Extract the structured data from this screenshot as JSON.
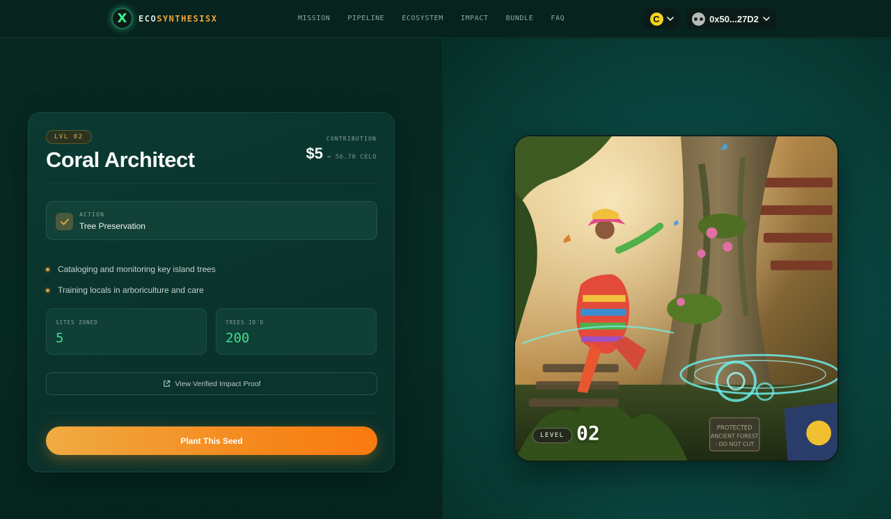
{
  "brand": {
    "badge": "X",
    "name_part1": "ECO",
    "name_part2": "SYNTHESIS",
    "name_part3": "X"
  },
  "nav": {
    "items": [
      "MISSION",
      "PIPELINE",
      "ECOSYSTEM",
      "IMPACT",
      "BUNDLE",
      "FAQ"
    ]
  },
  "wallet": {
    "token_symbol": "C",
    "token_icon": "celo-coin-icon",
    "address": "0x50...27D2"
  },
  "card": {
    "level_pill": "LVL 02",
    "title": "Coral Architect",
    "contribution_label": "CONTRIBUTION",
    "contribution_usd": "$5",
    "contribution_celo": "≈ 56.70 CELO",
    "action_label": "ACTION",
    "action_value": "Tree Preservation",
    "bullets": [
      "Cataloging and monitoring key island trees",
      "Training locals in arboriculture and care"
    ],
    "stats": [
      {
        "label": "SITES ZONED",
        "value": "5"
      },
      {
        "label": "TREES ID'D",
        "value": "200"
      }
    ],
    "proof_button": "View Verified Impact Proof",
    "plant_button": "Plant This Seed"
  },
  "nft": {
    "level_label": "LEVEL",
    "level_number": "02",
    "sign_text_line1": "PROTECTED",
    "sign_text_line2": "ANCIENT FOREST",
    "sign_text_line3": "- DO NOT CUT"
  },
  "colors": {
    "accent_orange": "#f58a1e",
    "accent_green": "#3ee089",
    "accent_gold": "#e3b24a",
    "background": "#062822"
  }
}
